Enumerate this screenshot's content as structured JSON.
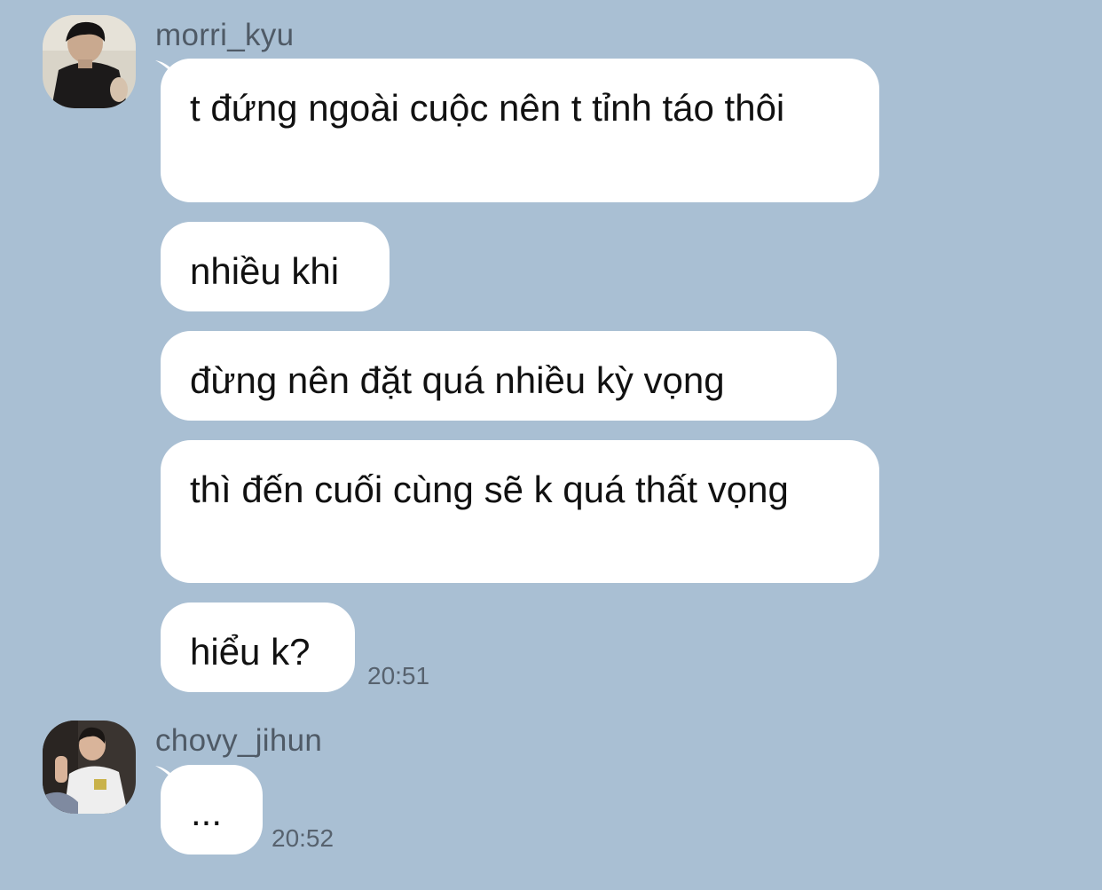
{
  "messages": [
    {
      "sender": "morri_kyu",
      "bubbles": [
        "t đứng ngoài cuộc nên t tỉnh táo thôi",
        "nhiều khi",
        "đừng nên đặt quá nhiều kỳ vọng",
        "thì đến cuối cùng sẽ k quá thất vọng",
        "hiểu k?"
      ],
      "time": "20:51"
    },
    {
      "sender": "chovy_jihun",
      "bubbles": [
        "..."
      ],
      "time": "20:52"
    }
  ],
  "colors": {
    "background": "#a9bfd3",
    "bubble": "#ffffff",
    "text": "#111111",
    "meta_text": "#57626e"
  },
  "icons": {
    "avatar_1": "user-photo-avatar",
    "avatar_2": "user-photo-avatar"
  }
}
